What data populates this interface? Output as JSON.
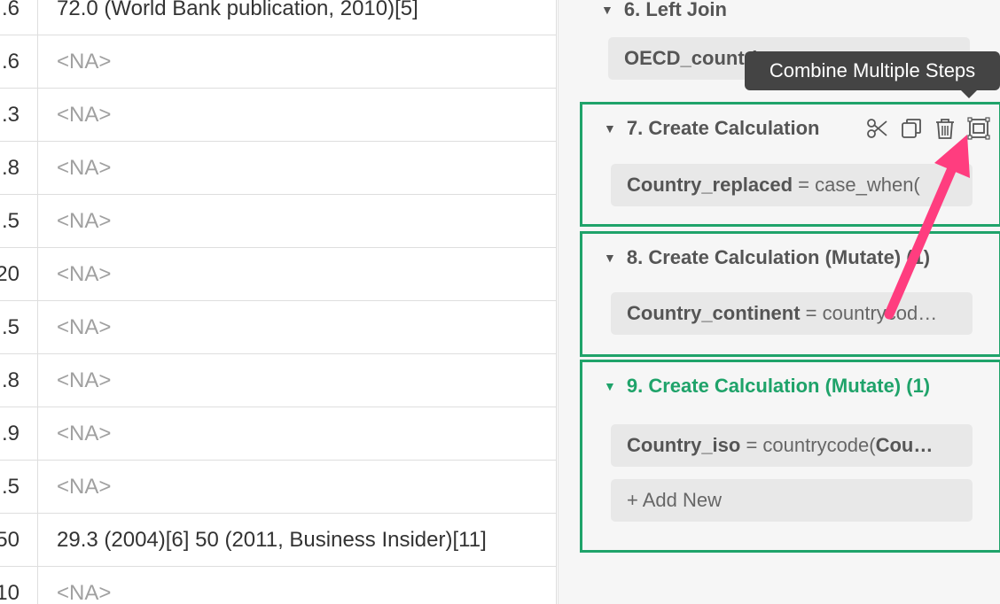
{
  "table": {
    "rows": [
      {
        "a": ".6",
        "b": "72.0 (World Bank publication, 2010)[5]",
        "na": false
      },
      {
        "a": ".6",
        "b": "<NA>",
        "na": true
      },
      {
        "a": ".3",
        "b": "<NA>",
        "na": true
      },
      {
        "a": ".8",
        "b": "<NA>",
        "na": true
      },
      {
        "a": ".5",
        "b": "<NA>",
        "na": true
      },
      {
        "a": "20",
        "b": "<NA>",
        "na": true
      },
      {
        "a": ".5",
        "b": "<NA>",
        "na": true
      },
      {
        "a": ".8",
        "b": "<NA>",
        "na": true
      },
      {
        "a": ".9",
        "b": "<NA>",
        "na": true
      },
      {
        "a": ".5",
        "b": "<NA>",
        "na": true
      },
      {
        "a": "50",
        "b": "29.3 (2004)[6] 50 (2011, Business Insider)[11]",
        "na": false
      },
      {
        "a": "10",
        "b": "<NA>",
        "na": true
      }
    ]
  },
  "steps": {
    "step6": {
      "title": "6. Left Join",
      "pill": "OECD_countries"
    },
    "step7": {
      "title": "7. Create Calculation",
      "pill_key": "Country_replaced",
      "pill_val": " = case_when("
    },
    "step8": {
      "title": "8. Create Calculation (Mutate) (1)",
      "pill_key": "Country_continent",
      "pill_val": " = countrycod…"
    },
    "step9": {
      "title": "9. Create Calculation (Mutate) (1)",
      "pill_key": "Country_iso",
      "pill_val": " = countrycode(",
      "pill_key2": "Cou…"
    },
    "add_new": "+ Add New"
  },
  "tooltip": "Combine Multiple Steps",
  "icons": [
    "scissors-icon",
    "copy-icon",
    "trash-icon",
    "combine-steps-icon"
  ],
  "colors": {
    "active_green": "#1fa36a",
    "arrow": "#ff3d7f",
    "tooltip_bg": "#444444"
  }
}
